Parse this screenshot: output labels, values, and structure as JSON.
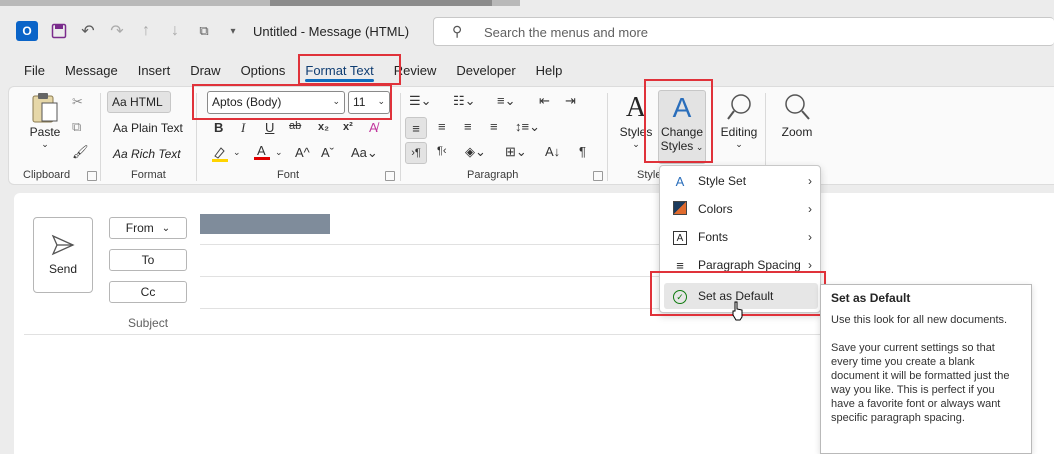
{
  "titlebar": {
    "title": "Untitled  -  Message (HTML)",
    "search_placeholder": "Search the menus and more",
    "icons": [
      "outlook-icon",
      "save-icon",
      "undo-icon",
      "redo-icon",
      "up-icon",
      "down-icon",
      "quick-steps-icon",
      "customize-icon",
      "search-icon"
    ]
  },
  "tabs": [
    {
      "label": "File"
    },
    {
      "label": "Message"
    },
    {
      "label": "Insert"
    },
    {
      "label": "Draw"
    },
    {
      "label": "Options"
    },
    {
      "label": "Format Text",
      "active": true
    },
    {
      "label": "Review"
    },
    {
      "label": "Developer"
    },
    {
      "label": "Help"
    }
  ],
  "ribbon": {
    "clipboard": {
      "paste": "Paste",
      "label": "Clipboard"
    },
    "format": {
      "html": "Aa HTML",
      "plain": "Aa Plain Text",
      "rich": "Aa Rich Text",
      "label": "Format"
    },
    "font": {
      "name": "Aptos (Body)",
      "size": "11",
      "label": "Font"
    },
    "paragraph": {
      "label": "Paragraph"
    },
    "styles": {
      "styles": "Styles",
      "change_styles_1": "Change",
      "change_styles_2": "Styles",
      "label": "Style"
    },
    "editing": {
      "label": "Editing"
    },
    "zoom": {
      "label": "Zoom"
    }
  },
  "compose": {
    "send": "Send",
    "from": "From",
    "to": "To",
    "cc": "Cc",
    "subject": "Subject"
  },
  "dropdown": {
    "items": [
      {
        "label": "Style Set",
        "icon": "style-set-icon",
        "submenu": true
      },
      {
        "label": "Colors",
        "icon": "colors-icon",
        "submenu": true
      },
      {
        "label": "Fonts",
        "icon": "fonts-icon",
        "submenu": true
      },
      {
        "label": "Paragraph Spacing",
        "icon": "paragraph-spacing-icon",
        "submenu": true
      },
      {
        "label": "Set as Default",
        "icon": "check-circle-icon",
        "submenu": false,
        "highlighted": true
      }
    ]
  },
  "tooltip": {
    "title": "Set as Default",
    "p1": "Use this look for all new documents.",
    "p2": "Save your current settings so that every time you create a blank document it will be formatted just the way you like. This is perfect if you have a favorite font or always want specific paragraph spacing."
  },
  "colors": {
    "accent": "#0f6cbd",
    "highlight_box": "#e0323a",
    "text_highlight": "#ffd400",
    "font_color": "#e00000"
  }
}
